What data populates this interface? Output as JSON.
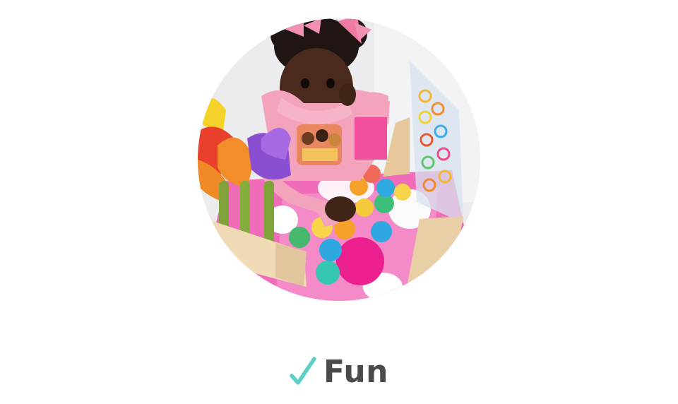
{
  "feature": {
    "label": "Fun",
    "check_icon": "checkmark-icon",
    "check_color": "#5ccfc6",
    "text_color": "#4a4b4d"
  },
  "photo": {
    "subject": "child-playing-with-colorful-toys-photo",
    "shape": "circle"
  }
}
